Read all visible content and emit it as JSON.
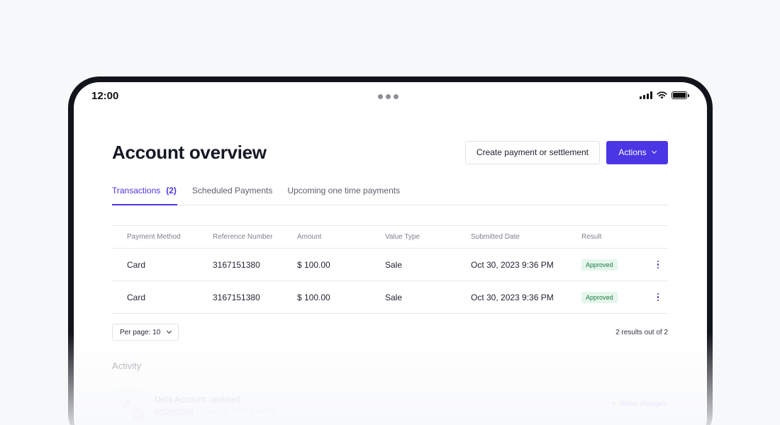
{
  "status_bar": {
    "time": "12:00"
  },
  "header": {
    "title": "Account overview",
    "create_button": "Create payment or settlement",
    "actions_button": "Actions"
  },
  "tabs": [
    {
      "label": "Transactions",
      "count": "(2)",
      "active": true
    },
    {
      "label": "Scheduled Payments",
      "active": false
    },
    {
      "label": "Upcoming one time payments",
      "active": false
    }
  ],
  "table": {
    "columns": [
      "Payment Method",
      "Reference Number",
      "Amount",
      "Value Type",
      "Submitted Date",
      "Result"
    ],
    "rows": [
      {
        "method": "Card",
        "reference": "3167151380",
        "amount": "$ 100.00",
        "value_type": "Sale",
        "date": "Oct 30, 2023 9:36 PM",
        "result": "Approved"
      },
      {
        "method": "Card",
        "reference": "3167151380",
        "amount": "$ 100.00",
        "value_type": "Sale",
        "date": "Oct 30, 2023 9:36 PM",
        "result": "Approved"
      }
    ]
  },
  "pagination": {
    "per_page": "Per page: 10",
    "results": "2 results out of 2"
  },
  "activity": {
    "title": "Activity",
    "items": [
      {
        "title": "Debt Account: updated",
        "link": "#AQH95584",
        "date": "Oct 30, 2023 9:36 PM",
        "action": "Show changes"
      }
    ]
  },
  "colors": {
    "accent": "#4b36e5",
    "success_bg": "#e6f6ec",
    "success_text": "#187a3e"
  },
  "icons": [
    "signal-icon",
    "wifi-icon",
    "battery-icon",
    "chevron-down-icon",
    "more-vertical-icon",
    "link-icon",
    "edit-icon",
    "plus-icon"
  ]
}
